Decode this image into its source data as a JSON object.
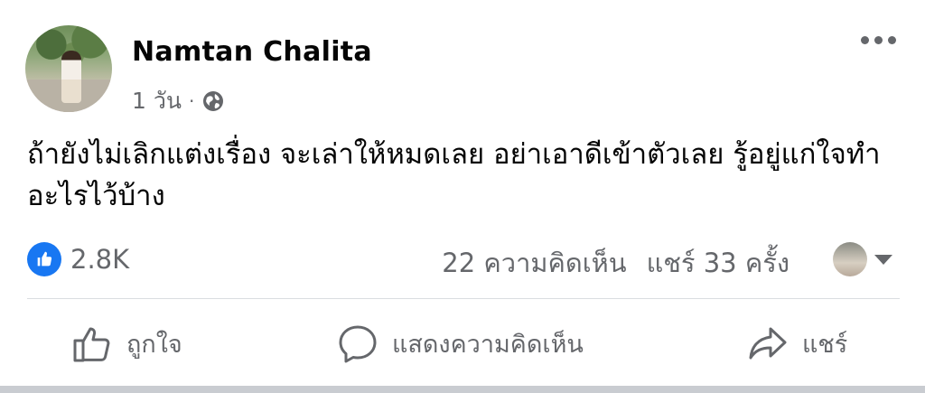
{
  "post": {
    "author": "Namtan Chalita",
    "time": "1 วัน",
    "separator": "·",
    "privacy_icon": "globe-icon",
    "text": "ถ้ายังไม่เลิกแต่งเรื่อง จะเล่าให้หมดเลย อย่าเอาดีเข้าตัวเลย รู้อยู่แก่ใจทำอะไรไว้บ้าง"
  },
  "reactions": {
    "like_count": "2.8K",
    "comments": "22 ความคิดเห็น",
    "shares": "แชร์ 33 ครั้ง"
  },
  "actions": {
    "like_label": "ถูกใจ",
    "comment_label": "แสดงความคิดเห็น",
    "share_label": "แชร์"
  },
  "colors": {
    "accent": "#1877f2",
    "secondary_text": "#65676b",
    "divider": "#dadde1"
  }
}
